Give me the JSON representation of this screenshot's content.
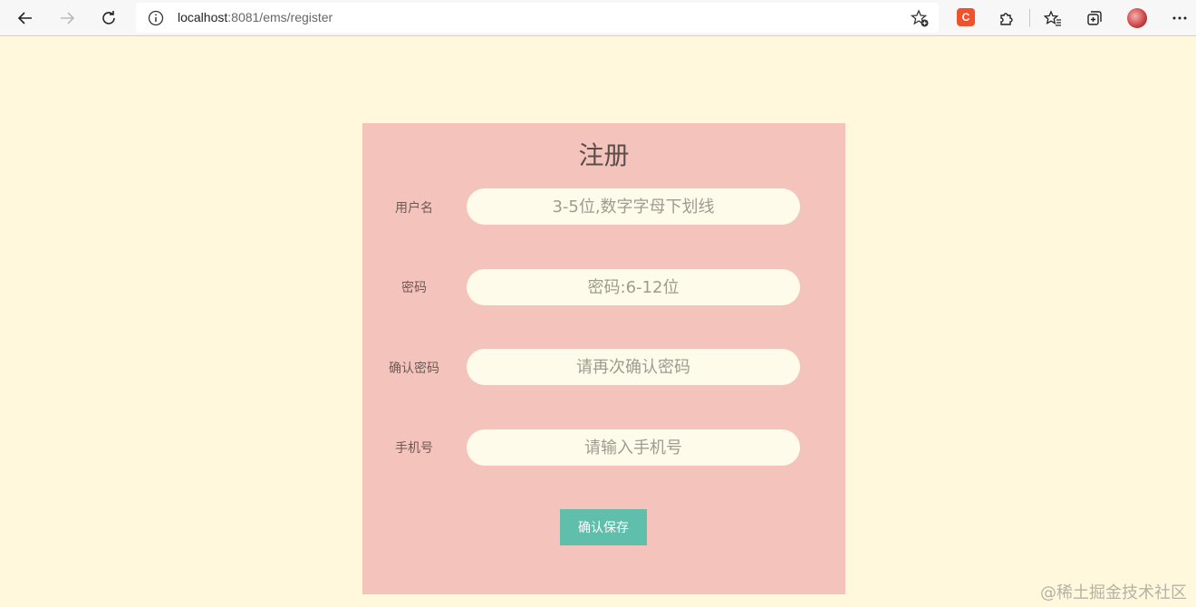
{
  "browser": {
    "url_host": "localhost",
    "url_rest": ":8081/ems/register",
    "extension_label": "C"
  },
  "form": {
    "title": "注册",
    "fields": [
      {
        "label": "用户名",
        "placeholder": "3-5位,数字字母下划线"
      },
      {
        "label": "密码",
        "placeholder": "密码:6-12位"
      },
      {
        "label": "确认密码",
        "placeholder": "请再次确认密码"
      },
      {
        "label": "手机号",
        "placeholder": "请输入手机号"
      }
    ],
    "submit_label": "确认保存"
  },
  "watermark": "@稀土掘金技术社区",
  "colors": {
    "page_bg": "#fff8dc",
    "card_bg": "#f4c4bc",
    "input_bg": "#fffbea",
    "button_bg": "#5fbfab",
    "extension_accent": "#f0522e"
  },
  "icons": {
    "back": "arrow-left-icon",
    "forward": "arrow-right-icon",
    "refresh": "refresh-icon",
    "info": "info-icon",
    "favorite_add": "star-plus-icon",
    "extensions": "puzzle-icon",
    "favorites": "star-list-icon",
    "collections": "collections-icon",
    "more": "more-dots-icon"
  }
}
